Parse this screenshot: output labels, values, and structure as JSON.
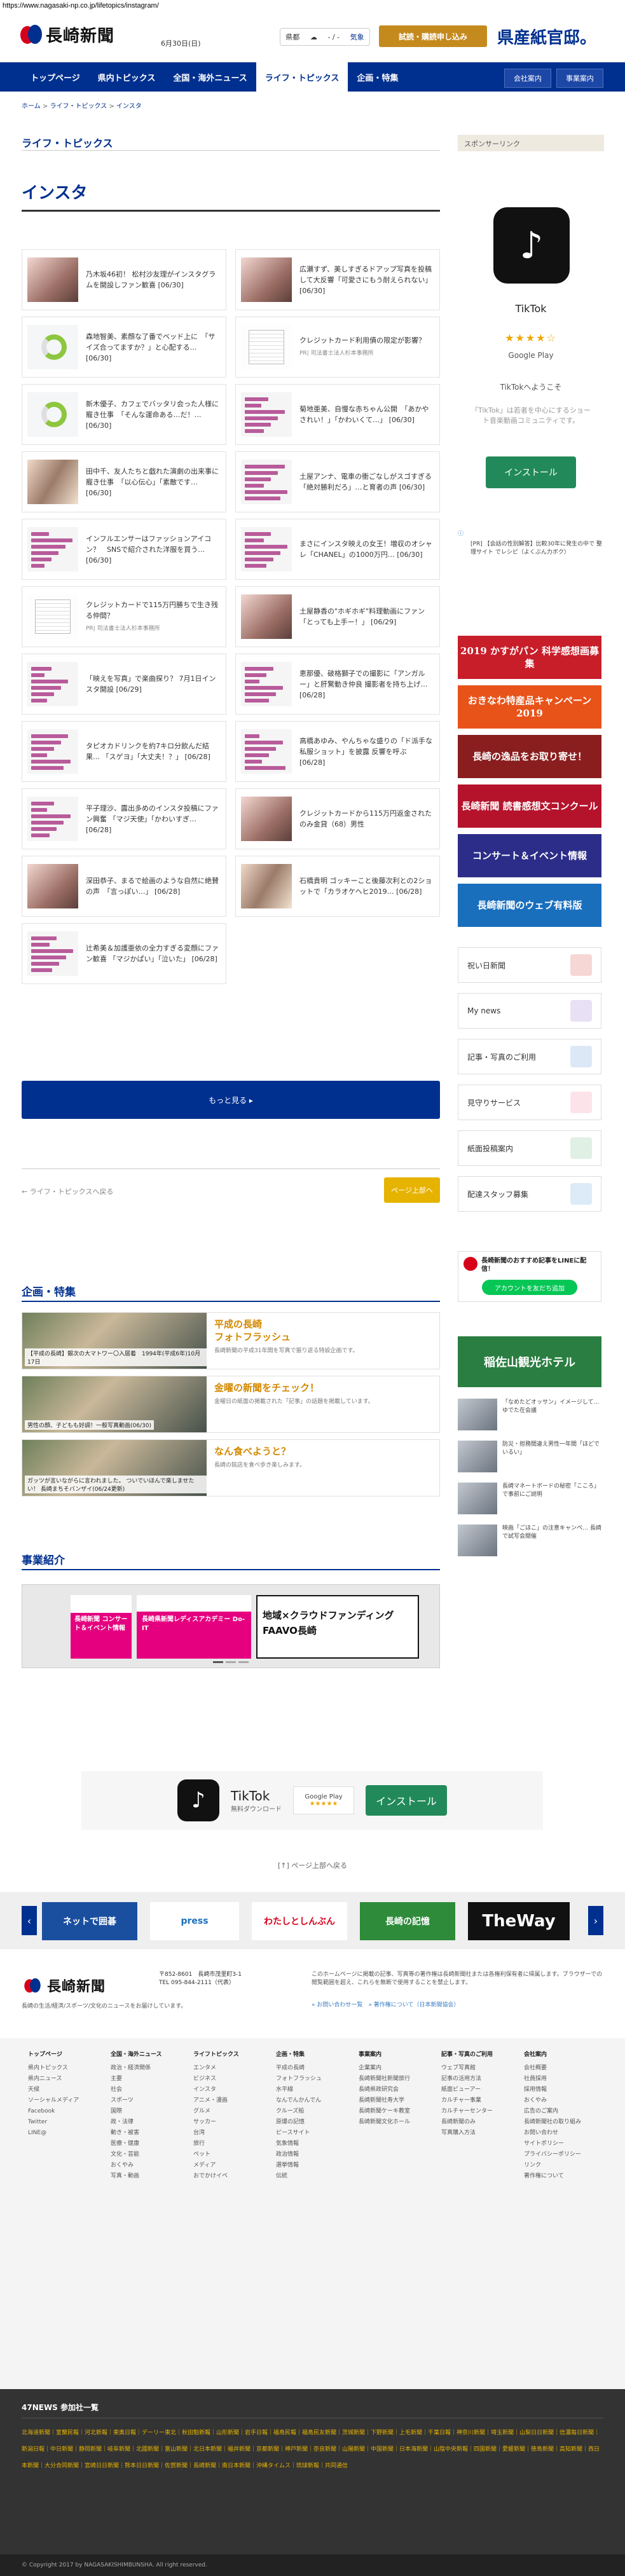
{
  "url": "https://www.nagasaki-np.co.jp/lifetopics/instagram/",
  "header": {
    "logo_text": "長崎新聞",
    "date": "6月30日(日)",
    "weather": {
      "area": "県都",
      "temp": "- / -",
      "label": "気象"
    },
    "trial_button": "試読・購読申し込み",
    "product_button": "県産紙官邸。"
  },
  "nav": {
    "items": [
      "トップページ",
      "県内トピックス",
      "全国・海外ニュース",
      "ライフ・トピックス",
      "企画・特集"
    ],
    "active_index": 3,
    "right": [
      "会社案内",
      "事業案内"
    ]
  },
  "breadcrumb": [
    "ホーム",
    "ライフ・トピックス",
    "インスタ"
  ],
  "section_title": "ライフ・トピックス",
  "page_title": "インスタ",
  "articles": [
    {
      "text": "乃木坂46初！ 松村沙友理がインスタグラムを開設しファン歓喜 [06/30]",
      "thumb": "t-img"
    },
    {
      "text": "広瀬すず、美しすぎるドアップ写真を投稿して大反響「可愛さにもう耐えられない」 [06/30]",
      "thumb": "t-img"
    },
    {
      "text": "森地智美、素顔な了番でベッド上に　「サイズ合ってますか？」と心配する… [06/30]",
      "thumb": "t-donut"
    },
    {
      "text": "クレジットカード利用債の限定が影響？",
      "pr": "PR| 司法書士法人杉本事務所",
      "thumb": "t-doc"
    },
    {
      "text": "新木優子、カフェでバッタリ会った人様に寵き仕事　「そんな運命ある…だ！… [06/30]",
      "thumb": "t-donut"
    },
    {
      "text": "菊地亜美、自慢な赤ちゃん公開　「あかやされい！」「かわいくて…」 [06/30]",
      "thumb": "t-chart"
    },
    {
      "text": "田中千、友人たちと戯れた演劇の出来事に寵き仕事　「以心伝心」「素敵です… [06/30]",
      "thumb": "t-mix"
    },
    {
      "text": "土屋アンナ、電車の衝ごなしがスゴすぎる　「絶対勝利だろ」…と育者の声 [06/30]",
      "thumb": "t-chart"
    },
    {
      "text": "インフルエンサーはファッションアイコン？　SNSで紹介された洋服を買う… [06/30]",
      "thumb": "t-chart"
    },
    {
      "text": "まさにインスタ映えの女王！増収のオシャレ「CHANEL」の1000万円… [06/30]",
      "thumb": "t-chart"
    },
    {
      "text": "クレジットカードで115万円勝ちで生き残る仲間？",
      "pr": "PR| 司法書士法人杉本事務所",
      "thumb": "t-doc"
    },
    {
      "text": "土屋静香の\"ホギホギ\"料理動画にファン「とっても上手ー！」 [06/29]",
      "thumb": "t-img"
    },
    {
      "text": "「映えを写真」で楽曲探り？ 7月1日インスタ開設 [06/29]",
      "thumb": "t-chart"
    },
    {
      "text": "恵那優、破格獅子での撮影に「アンガルー」と肝驚動き仲良 撮影者を持ち上げ… [06/28]",
      "thumb": "t-chart"
    },
    {
      "text": "タピオカドリンクを約7キロ分飲んだ結果… 「スゲヨ」「大丈夫！？」 [06/28]",
      "thumb": "t-chart"
    },
    {
      "text": "高橋あゆみ、やんちゃな盛りの「ド派手な私服ショット」を披露 反響を呼ぶ [06/28]",
      "thumb": "t-chart"
    },
    {
      "text": "平子理沙、露出多めのインスタ投稿にファン興奮 「マジ天使」「かわいすぎ… [06/28]",
      "thumb": "t-chart"
    },
    {
      "text": "クレジットカードから115万円返金されたのみ金貸（68）男性",
      "thumb": "t-img"
    },
    {
      "text": "深田恭子、まるで絵画のような自然に絶賛の声　「言っぽい…」 [06/28]",
      "thumb": "t-img"
    },
    {
      "text": "石橋貴明 ゴッキーこと後藤次利との2ショットで「カラオケヘヒ2019… [06/28]",
      "thumb": "t-mix"
    },
    {
      "text": "辻希美＆加護亜依の全力すぎる変顔にファン歓喜 「マジかぱい」「泣いた」 [06/28]",
      "thumb": "t-chart"
    }
  ],
  "more_button": "もっと見る ▸",
  "pagination": {
    "back": "← ライフ・トピックスへ戻る",
    "next": "ページ上部へ"
  },
  "kikaku": {
    "title": "企画・特集",
    "items": [
      {
        "caption": "【平成の長崎】銀次の大マトワー〇入居着　1994年(平成6年)10月17日",
        "title": "平成の長崎\nフォトフラッシュ",
        "desc": "長崎新聞の平成31年間を写真で振り返る特設企画です。"
      },
      {
        "caption": "男性の顔、子どもも好調！一般写真動画(06/30)",
        "title": "金曜の新聞をチェック！",
        "desc": "金曜日の紙面の掲載された「記事」の話題を掲載しています。"
      },
      {
        "caption": "ガッツが言いながらに言われました。 ついでいほんで楽しませたい！ 長崎まちそバンザイ(06/24更新)",
        "title": "なん食べようと？",
        "desc": "長崎の銘店を食べ歩き楽しみます。"
      }
    ]
  },
  "jigyo": {
    "title": "事業紹介",
    "cards": [
      "長崎新聞 コンサート＆イベント情報",
      "長崎県新聞レディスアカデミー Do-IT",
      "地域×クラウドファンディング FAAVO長崎"
    ]
  },
  "sidebar": {
    "sponsor_label": "スポンサーリンク",
    "tiktok": {
      "name": "TikTok",
      "stars": "★★★★☆",
      "store": "Google Play",
      "welcome": "TikTokへようこそ",
      "desc": "「TikTok」は若者を中心にするショート音楽動画コミュニティです。",
      "install": "インストール"
    },
    "ad_mark": "ⓘ",
    "ad_text": "[PR] 【会話の性別解答】比較30年に発生の中で 整理サイト でレシピ（よくぶん力ボク）",
    "banners": [
      "2019 かすがパン 科学感想画募集",
      "おきなわ特産品キャンペーン 2019",
      "長崎の逸品をお取り寄せ！",
      "長崎新聞 読書感想文コンクール",
      "コンサート＆イベント情報",
      "長崎新聞のウェブ有料版"
    ],
    "services": [
      "祝い日新聞",
      "My news",
      "記事・写真のご利用",
      "見守りサービス",
      "紙面投稿案内",
      "配達スタッフ募集"
    ],
    "line": {
      "title": "長崎新聞のおすすめ記事をLINEに配信！",
      "button": "アカウントを友だち追加"
    },
    "hotel": "稲佐山観光ホテル",
    "side_news": [
      "「なめたどオッサン」イメージして… ゆでた在会議",
      "防災・担務間違え男性一年間「ほどでいるい」",
      "長崎マネートボードの秘密「こころ」で事前にご説明",
      "映画「ごほこ」の注意キャンペ… 長崎で試写会開催"
    ]
  },
  "bottom_ad": {
    "name": "TikTok",
    "sub": "無料ダウンロード",
    "store": "Google Play",
    "stars": "★★★★★",
    "install": "インストール"
  },
  "to_top": "[↑] ページ上部へ戻る",
  "banner_row": [
    "ネットで囲碁",
    "press",
    "わたしとしんぶん",
    "長崎の記憶",
    "TheWay"
  ],
  "footer": {
    "logo": "長崎新聞",
    "address": "〒852-8601　長崎市茂里町3-1\nTEL 095-844-2111（代表）",
    "tagline": "長崎の生活/経済/スポーツ/文化のニュースをお届けしています。",
    "note": "このホームページに掲載の記事、写真等の著作権は長崎新聞社または各権利保有者に帰属します。ブラウザーでの閲覧範囲を超え、これらを無断で使用することを禁止します。",
    "links": "» お問い合わせ一覧　» 著作権について（日本新聞協会）",
    "columns": [
      {
        "heading": "トップページ",
        "items": [
          "県内トピックス",
          "県内ニュース",
          "天候",
          "ソーシャルメディア",
          "Facebook",
          "Twitter",
          "LINE@"
        ]
      },
      {
        "heading": "全国・海外ニュース",
        "items": [
          "政治・経済関係",
          "主要",
          "社会",
          "スポーツ",
          "国際",
          "政・法律",
          "動き・被害",
          "医療・健康",
          "文化・芸能",
          "おくやみ",
          "写真・動画"
        ]
      },
      {
        "heading": "ライフトピックス",
        "items": [
          "エンタメ",
          "ビジネス",
          "インスタ",
          "アニメ・漫画",
          "グルメ",
          "サッカー",
          "台湾",
          "旅行",
          "ペット",
          "メディア",
          "おでかけイベ"
        ]
      },
      {
        "heading": "企画・特集",
        "items": [
          "平成の長崎",
          "フォトフラッシュ",
          "水平線",
          "なんでんかんでん",
          "クルーズ船",
          "原爆の記憶",
          "ピースサイト",
          "気象情報",
          "政治情報",
          "選挙情報",
          "伝統"
        ]
      },
      {
        "heading": "事業案内",
        "items": [
          "企業案内",
          "長崎新聞社新聞旅行",
          "長崎県政研究会",
          "長崎新聞社寿大学",
          "長崎新聞ケーキ教室",
          "長崎新聞文化ホール"
        ]
      },
      {
        "heading": "記事・写真のご利用",
        "items": [
          "ウェブ写真館",
          "記事の活用方法",
          "紙面ビューアー",
          "カルチャー事業",
          "カルチャーセンター",
          "長崎新聞のみ",
          "写真購入方法"
        ]
      },
      {
        "heading": "会社案内",
        "items": [
          "会社概要",
          "社員採用",
          "採用情報",
          "おくやみ",
          "広告のご案内",
          "長崎新聞社の取り組み",
          "お問い合わせ",
          "サイトポリシー",
          "プライバシーポリシー",
          "リンク",
          "著作権について"
        ]
      }
    ]
  },
  "news47": {
    "title": "47NEWS 参加社一覧",
    "papers": "北海道新聞｜室蘭民報｜河北新報｜東奥日報｜デーリー東北｜秋田魁新報｜山形新聞｜岩手日報｜福島民報｜福島民友新聞｜茨城新聞｜下野新聞｜上毛新聞｜千葉日報｜神奈川新聞｜埼玉新聞｜山梨日日新聞｜信濃毎日新聞｜新潟日報｜中日新聞｜静岡新聞｜岐阜新聞｜北國新聞｜富山新聞｜北日本新聞｜福井新聞｜京都新聞｜神戸新聞｜奈良新聞｜山陽新聞｜中国新聞｜日本海新聞｜山陰中央新報｜四国新聞｜愛媛新聞｜徳島新聞｜高知新聞｜西日本新聞｜大分合同新聞｜宮崎日日新聞｜熊本日日新聞｜佐賀新聞｜長崎新聞｜南日本新聞｜沖縄タイムス｜琉球新報｜共同通信"
  },
  "copyright": "© Copyright 2017 by NAGASAKISHIMBUNSHA. All right reserved.",
  "colors": {
    "brand": "#00308f",
    "accent": "#d7001a",
    "gold": "#e6b300"
  }
}
